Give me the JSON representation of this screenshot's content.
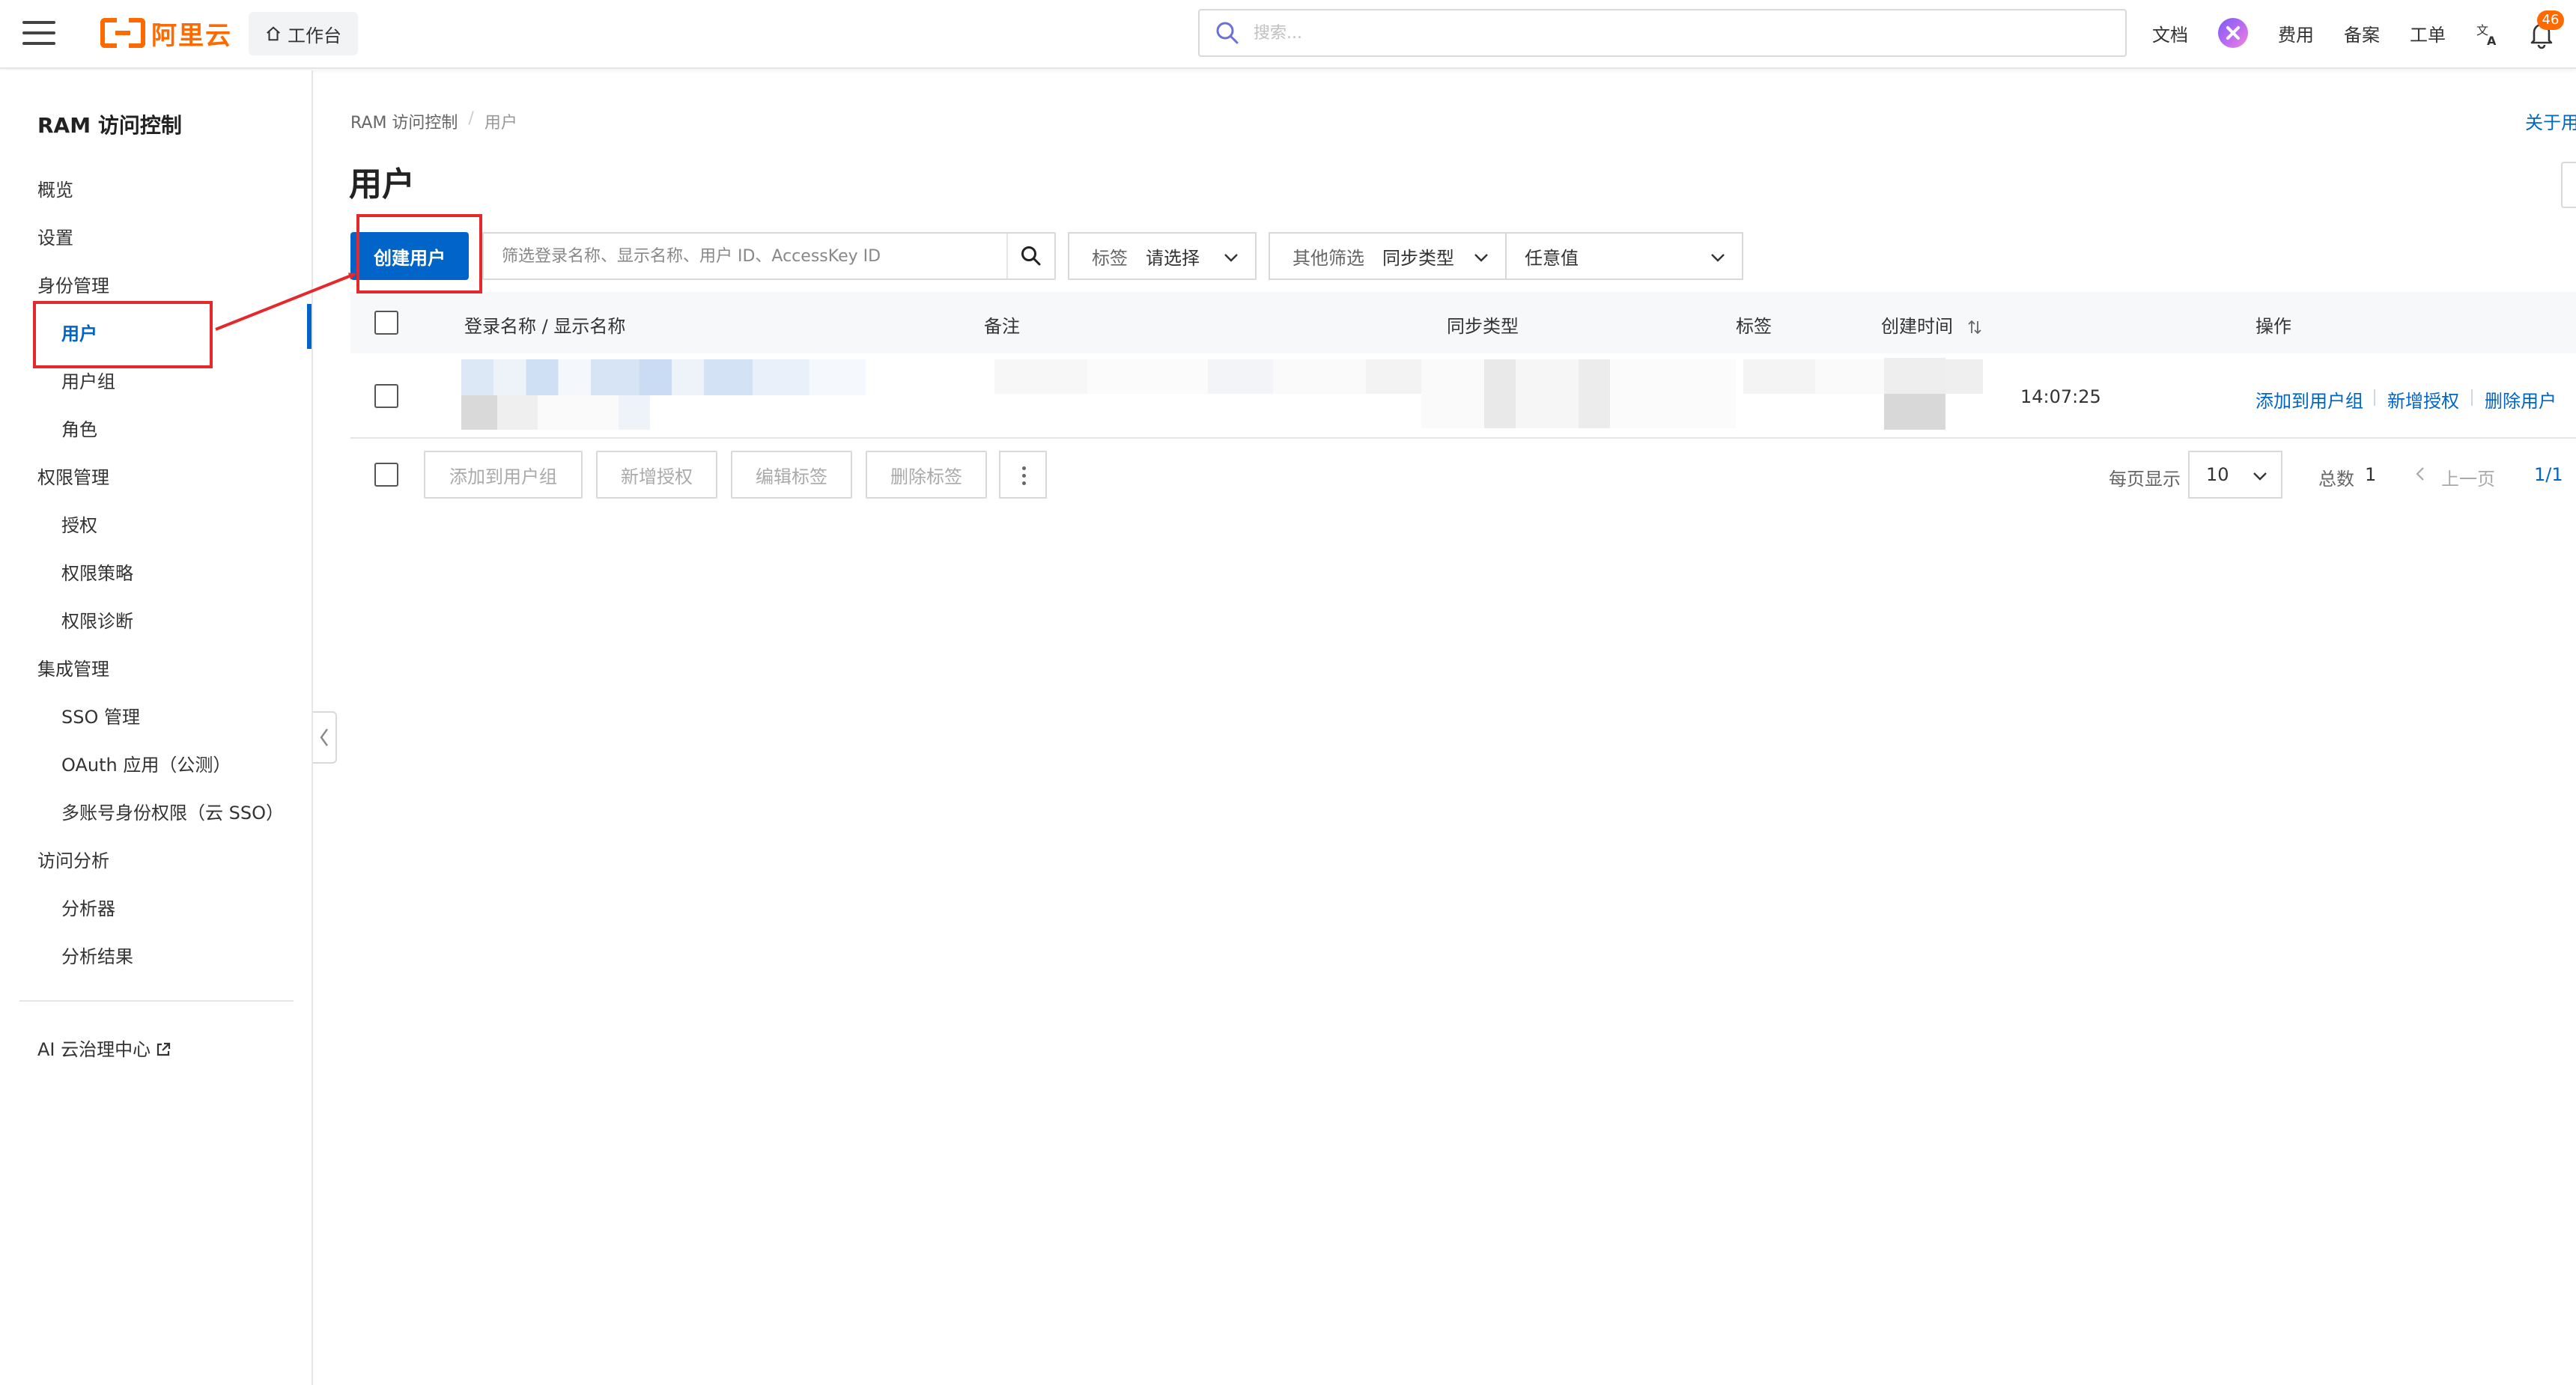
{
  "topbar": {
    "logo_text": "阿里云",
    "workbench_label": "工作台",
    "search_placeholder": "搜索...",
    "nav": {
      "docs": "文档",
      "billing": "费用",
      "icp": "备案",
      "tickets": "工单"
    },
    "notification_count": "46",
    "brand_color": "#ff6a00"
  },
  "sidebar": {
    "title": "RAM 访问控制",
    "items": [
      {
        "label": "概览"
      },
      {
        "label": "设置"
      },
      {
        "label": "身份管理"
      },
      {
        "label": "用户"
      },
      {
        "label": "用户组"
      },
      {
        "label": "角色"
      },
      {
        "label": "权限管理"
      },
      {
        "label": "授权"
      },
      {
        "label": "权限策略"
      },
      {
        "label": "权限诊断"
      },
      {
        "label": "集成管理"
      },
      {
        "label": "SSO 管理"
      },
      {
        "label": "OAuth 应用（公测）"
      },
      {
        "label": "多账号身份权限（云 SSO）"
      },
      {
        "label": "访问分析"
      },
      {
        "label": "分析器"
      },
      {
        "label": "分析结果"
      }
    ],
    "external_link": "AI 云治理中心",
    "active_item": "用户",
    "accent_color": "#0064c8"
  },
  "main": {
    "breadcrumb": [
      "RAM 访问控制",
      "用户"
    ],
    "about_link": "关于用",
    "title": "用户",
    "create_button": "创建用户",
    "filter_placeholder": "筛选登录名称、显示名称、用户 ID、AccessKey ID",
    "tag_filter": {
      "label": "标签",
      "value": "请选择"
    },
    "other_filter": {
      "label": "其他筛选",
      "value": "同步类型"
    },
    "any_value": "任意值",
    "table": {
      "headers": [
        "登录名称 / 显示名称",
        "备注",
        "同步类型",
        "标签",
        "创建时间",
        "操作"
      ],
      "rows": [
        {
          "created_time": "14:07:25",
          "actions": [
            "添加到用户组",
            "新增授权",
            "删除用户"
          ]
        }
      ]
    },
    "bulk_actions": [
      "添加到用户组",
      "新增授权",
      "编辑标签",
      "删除标签"
    ],
    "pager": {
      "per_page_label": "每页显示",
      "per_page_value": "10",
      "total_label": "总数",
      "total_value": "1",
      "prev_label": "上一页",
      "page_indicator": "1/1"
    }
  },
  "icons": [
    "hamburger-icon",
    "home-icon",
    "search-icon",
    "avatar-icon",
    "translate-icon",
    "bell-icon",
    "external-link-icon",
    "chevron-down-icon",
    "sort-icon",
    "more-icon",
    "chevron-left-icon"
  ]
}
